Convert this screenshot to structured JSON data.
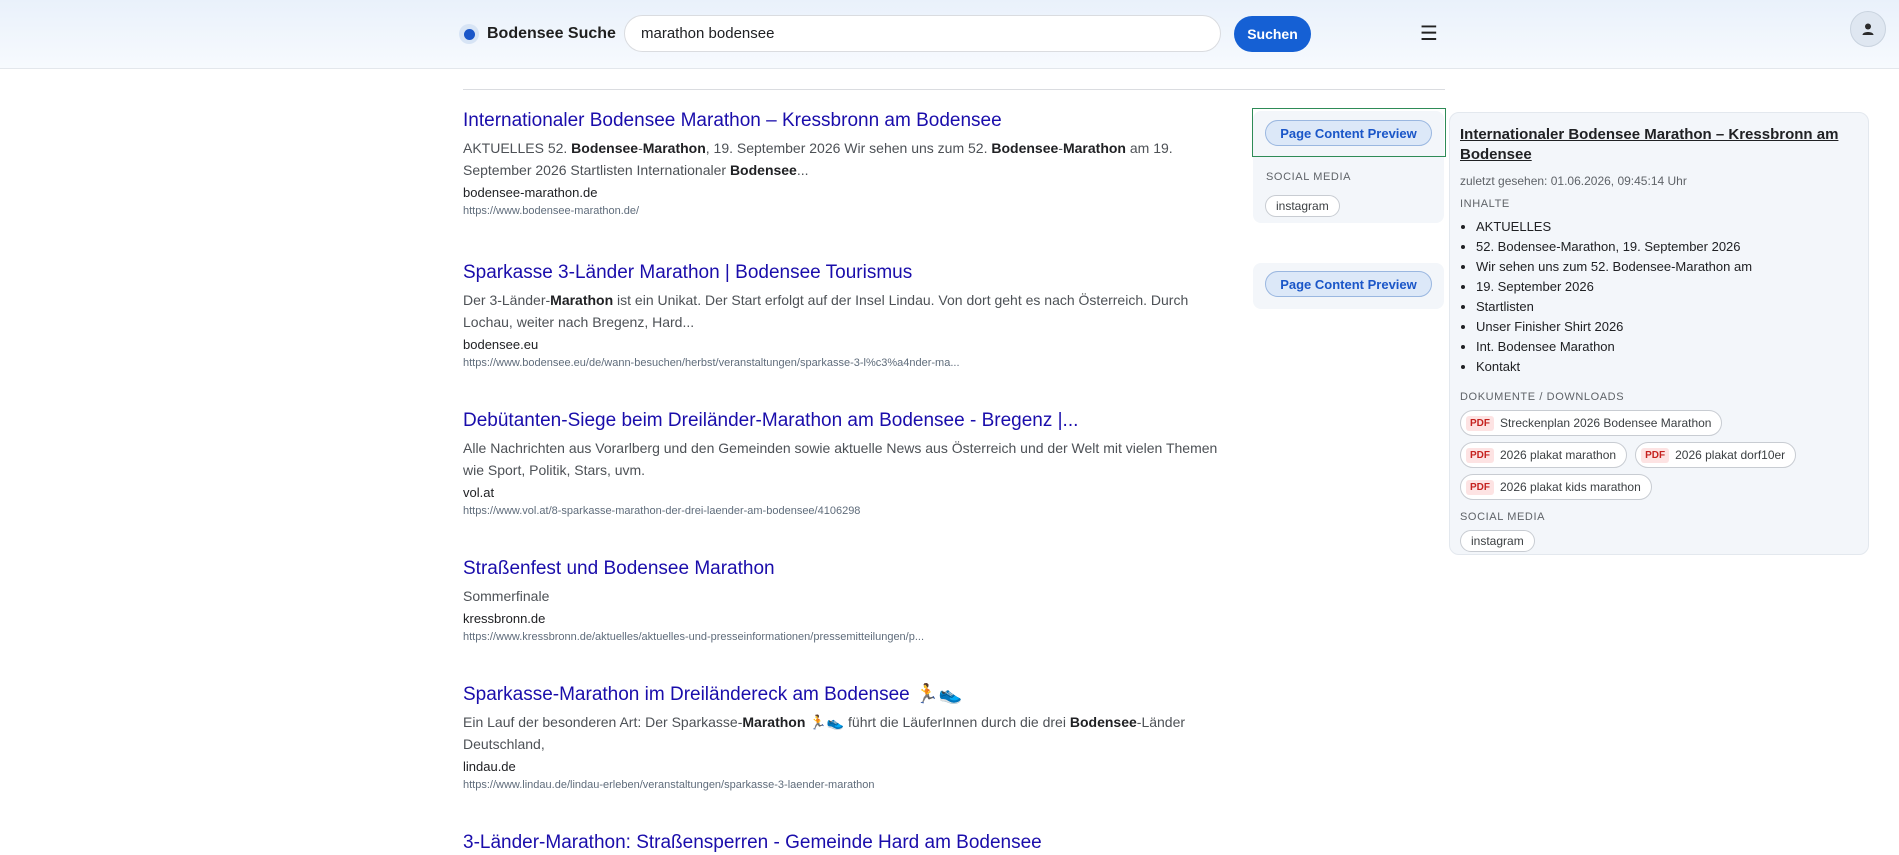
{
  "header": {
    "logo_text": "Bodensee Suche",
    "search_value": "marathon bodensee",
    "search_button": "Suchen",
    "menu_icon": "☰"
  },
  "results": [
    {
      "title": "Internationaler Bodensee Marathon – Kressbronn am Bodensee",
      "snippet": [
        "AKTUELLES 52. ",
        {
          "b": "Bodensee"
        },
        "-",
        {
          "b": "Marathon"
        },
        ", 19. September 2026 Wir sehen uns zum 52. ",
        {
          "b": "Bodensee"
        },
        "-",
        {
          "b": "Marathon"
        },
        " am 19. September 2026 Startlisten Internationaler ",
        {
          "b": "Bodensee"
        },
        "..."
      ],
      "domain": "bodensee-marathon.de",
      "url": "https://www.bodensee-marathon.de/"
    },
    {
      "title": "Sparkasse 3-Länder Marathon | Bodensee Tourismus",
      "snippet": [
        "Der 3-Länder-",
        {
          "b": "Marathon"
        },
        " ist ein Unikat. Der Start erfolgt auf der Insel Lindau. Von dort geht es nach Österreich. Durch Lochau, weiter nach Bregenz, Hard..."
      ],
      "domain": "bodensee.eu",
      "url": "https://www.bodensee.eu/de/wann-besuchen/herbst/veranstaltungen/sparkasse-3-l%c3%a4nder-ma..."
    },
    {
      "title": "Debütanten-Siege beim Dreiländer-Marathon am Bodensee - Bregenz |...",
      "snippet": [
        "Alle Nachrichten aus Vorarlberg und den Gemeinden sowie aktuelle News aus Österreich und der Welt mit vielen Themen wie Sport, Politik, Stars, uvm."
      ],
      "domain": "vol.at",
      "url": "https://www.vol.at/8-sparkasse-marathon-der-drei-laender-am-bodensee/4106298"
    },
    {
      "title": "Straßenfest und Bodensee Marathon",
      "snippet": [
        "Sommerfinale"
      ],
      "domain": "kressbronn.de",
      "url": "https://www.kressbronn.de/aktuelles/aktuelles-und-presseinformationen/pressemitteilungen/p..."
    },
    {
      "title": "Sparkasse-Marathon im Dreiländereck am Bodensee 🏃👟",
      "snippet": [
        "Ein Lauf der besonderen Art: Der Sparkasse-",
        {
          "b": "Marathon"
        },
        " 🏃👟 führt die LäuferInnen durch die drei ",
        {
          "b": "Bodensee"
        },
        "-Länder Deutschland,"
      ],
      "domain": "lindau.de",
      "url": "https://www.lindau.de/lindau-erleben/veranstaltungen/sparkasse-3-laender-marathon"
    },
    {
      "title": "3-Länder-Marathon: Straßensperren - Gemeinde Hard am Bodensee",
      "snippet": [],
      "domain": "",
      "url": ""
    }
  ],
  "side": {
    "preview_label": "Page Content Preview",
    "social_label": "SOCIAL MEDIA",
    "social_chip": "instagram"
  },
  "knowledge_panel": {
    "title": "Internationaler Bodensee Marathon – Kressbronn am Bodensee",
    "last_seen": "zuletzt gesehen: 01.06.2026, 09:45:14 Uhr",
    "contents_label": "INHALTE",
    "contents": [
      "AKTUELLES",
      "52. Bodensee-Marathon, 19. September 2026",
      "Wir sehen uns zum 52. Bodensee-Marathon am",
      "19. September 2026",
      "Startlisten",
      "Unser Finisher Shirt 2026",
      "Int. Bodensee Marathon",
      "Kontakt"
    ],
    "documents_label": "DOKUMENTE / DOWNLOADS",
    "pdf_tag": "PDF",
    "documents": [
      "Streckenplan 2026 Bodensee Marathon",
      "2026 plakat marathon",
      "2026 plakat dorf10er",
      "2026 plakat kids marathon"
    ],
    "social_label": "SOCIAL MEDIA",
    "social_chip": "instagram"
  },
  "colors": {
    "accent": "#1560d4",
    "link": "#1a0dab",
    "pdf": "#c5221f"
  }
}
